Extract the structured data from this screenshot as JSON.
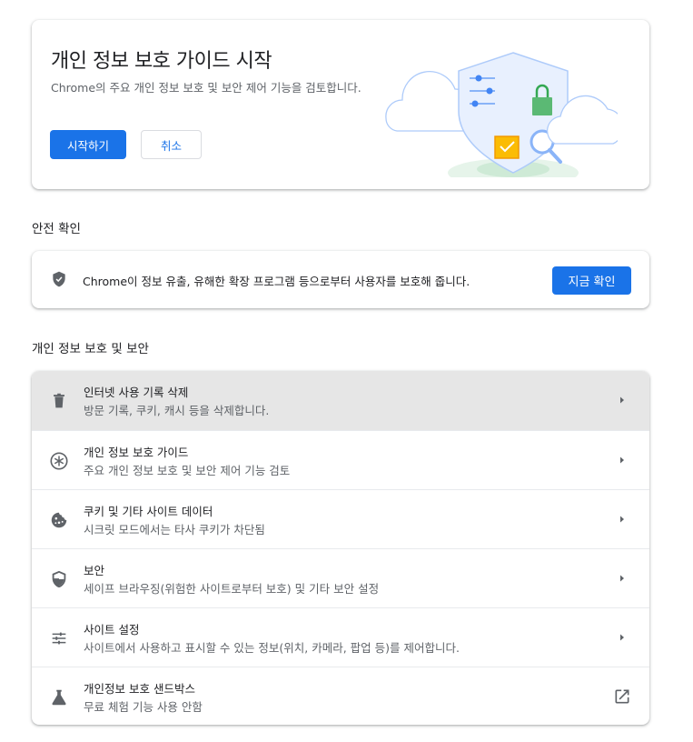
{
  "promo": {
    "title": "개인 정보 보호 가이드 시작",
    "description": "Chrome의 주요 개인 정보 보호 및 보안 제어 기능을 검토합니다.",
    "start_button": "시작하기",
    "cancel_button": "취소"
  },
  "safety_check": {
    "heading": "안전 확인",
    "text": "Chrome이 정보 유출, 유해한 확장 프로그램 등으로부터 사용자를 보호해 줍니다.",
    "button": "지금 확인"
  },
  "privacy": {
    "heading": "개인 정보 보호 및 보안",
    "items": [
      {
        "title": "인터넷 사용 기록 삭제",
        "subtitle": "방문 기록, 쿠키, 캐시 등을 삭제합니다.",
        "icon": "trash-icon",
        "action": "chevron-right-icon"
      },
      {
        "title": "개인 정보 보호 가이드",
        "subtitle": "주요 개인 정보 보호 및 보안 제어 기능 검토",
        "icon": "privacy-guide-icon",
        "action": "chevron-right-icon"
      },
      {
        "title": "쿠키 및 기타 사이트 데이터",
        "subtitle": "시크릿 모드에서는 타사 쿠키가 차단됨",
        "icon": "cookie-icon",
        "action": "chevron-right-icon"
      },
      {
        "title": "보안",
        "subtitle": "세이프 브라우징(위험한 사이트로부터 보호) 및 기타 보안 설정",
        "icon": "security-shield-icon",
        "action": "chevron-right-icon"
      },
      {
        "title": "사이트 설정",
        "subtitle": "사이트에서 사용하고 표시할 수 있는 정보(위치, 카메라, 팝업 등)를 제어합니다.",
        "icon": "tune-icon",
        "action": "chevron-right-icon"
      },
      {
        "title": "개인정보 보호 샌드박스",
        "subtitle": "무료 체험 기능 사용 안함",
        "icon": "flask-icon",
        "action": "open-in-new-icon"
      }
    ]
  },
  "colors": {
    "accent": "#1a73e8",
    "hover_row": "#e6e6e6",
    "icon": "#5f6368"
  }
}
